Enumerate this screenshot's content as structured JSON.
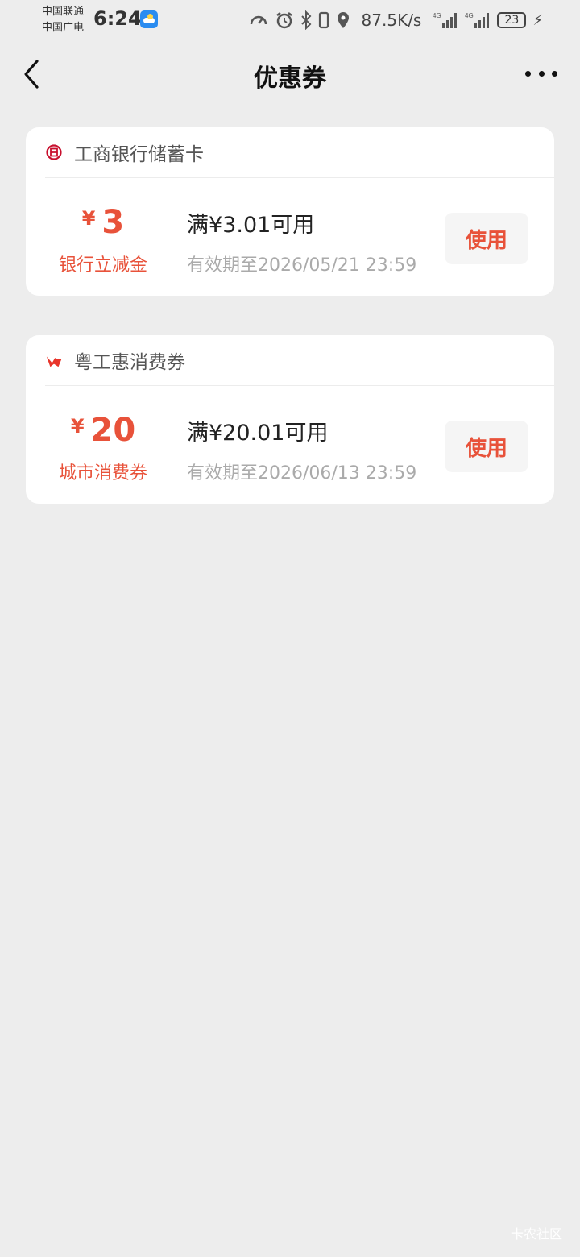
{
  "status_bar": {
    "carrier_1": "中国联通",
    "carrier_2": "中国广电",
    "time": "6:24",
    "net_speed": "87.5K/s",
    "battery": "23",
    "icons": [
      "speedometer-icon",
      "alarm-icon",
      "bluetooth-icon",
      "location-icon",
      "4g-signal-icon",
      "4g-signal-icon",
      "charging-icon"
    ]
  },
  "nav": {
    "title": "优惠券",
    "back_icon": "chevron-left-icon",
    "more_icon": "more-dots-icon"
  },
  "coupons": [
    {
      "issuer": "工商银行储蓄卡",
      "issuer_icon": "icbc-logo-icon",
      "yen": "¥",
      "amount": "3",
      "type": "银行立减金",
      "condition": "满¥3.01可用",
      "validity": "有效期至2026/05/21 23:59",
      "action": "使用"
    },
    {
      "issuer": "粤工惠消费券",
      "issuer_icon": "yuegonghui-logo-icon",
      "yen": "¥",
      "amount": "20",
      "type": "城市消费券",
      "condition": "满¥20.01可用",
      "validity": "有效期至2026/06/13 23:59",
      "action": "使用"
    }
  ],
  "colors": {
    "accent": "#e8523a",
    "background": "#ededed",
    "card": "#ffffff"
  },
  "watermark": "卡农社区"
}
